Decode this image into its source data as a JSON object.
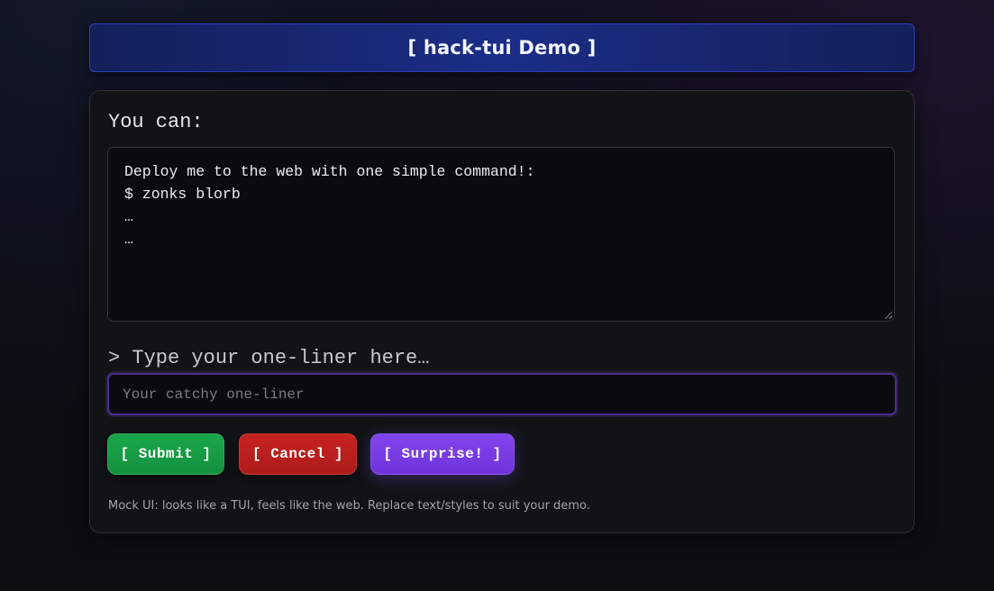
{
  "header": {
    "title": "[ hack-tui Demo ]"
  },
  "panel": {
    "section_label": "You can:",
    "terminal": {
      "lines": [
        "Deploy me to the web with one simple command!:",
        "$ zonks blorb",
        "…",
        "…"
      ]
    },
    "oneliner_label": "> Type your one-liner here…",
    "oneliner_input": {
      "value": "",
      "placeholder": "Your catchy one-liner"
    },
    "buttons": {
      "submit_label": "[ Submit ]",
      "cancel_label": "[ Cancel ]",
      "surprise_label": "[ Surprise! ]"
    },
    "footnote": "Mock UI: looks like a TUI, feels like the web. Replace text/styles to suit your demo."
  },
  "colors": {
    "background": "#0c0e14",
    "header_accent": "#1b2d86",
    "submit": "#15913f",
    "cancel": "#ad1c1a",
    "surprise": "#6f34db",
    "input_focus_border": "#4b2f8a"
  }
}
